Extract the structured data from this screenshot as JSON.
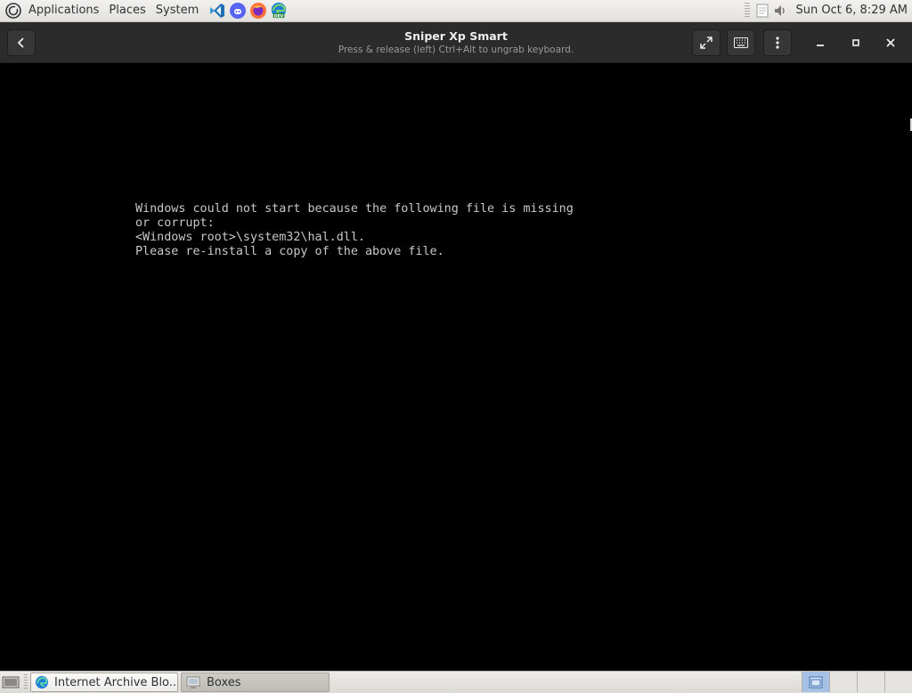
{
  "top_panel": {
    "menus": [
      "Applications",
      "Places",
      "System"
    ],
    "launchers": [
      "vscode-icon",
      "discord-icon",
      "firefox-icon",
      "edge-dev-icon"
    ],
    "launcher_badges": {
      "edge_dev": "DEV"
    },
    "clock": "Sun Oct  6,  8:29 AM"
  },
  "window": {
    "title": "Sniper Xp Smart",
    "subtitle": "Press & release (left) Ctrl+Alt to ungrab keyboard."
  },
  "vm_screen": {
    "lines": [
      "Windows could not start because the following file is missing",
      "or corrupt:",
      "<Windows root>\\system32\\hal.dll.",
      "Please re-install a copy of the above file."
    ]
  },
  "taskbar": {
    "tasks": [
      {
        "label": "Internet Archive Blo...",
        "icon": "edge-icon",
        "active": true
      },
      {
        "label": "Boxes",
        "icon": "boxes-icon",
        "active": false
      }
    ],
    "workspace_count": 4,
    "active_workspace": 1
  },
  "colors": {
    "panel_bg": "#e8e6e3",
    "headerbar_bg": "#2b2b2b",
    "vm_bg": "#000000",
    "vm_text": "#c8c8c8"
  }
}
